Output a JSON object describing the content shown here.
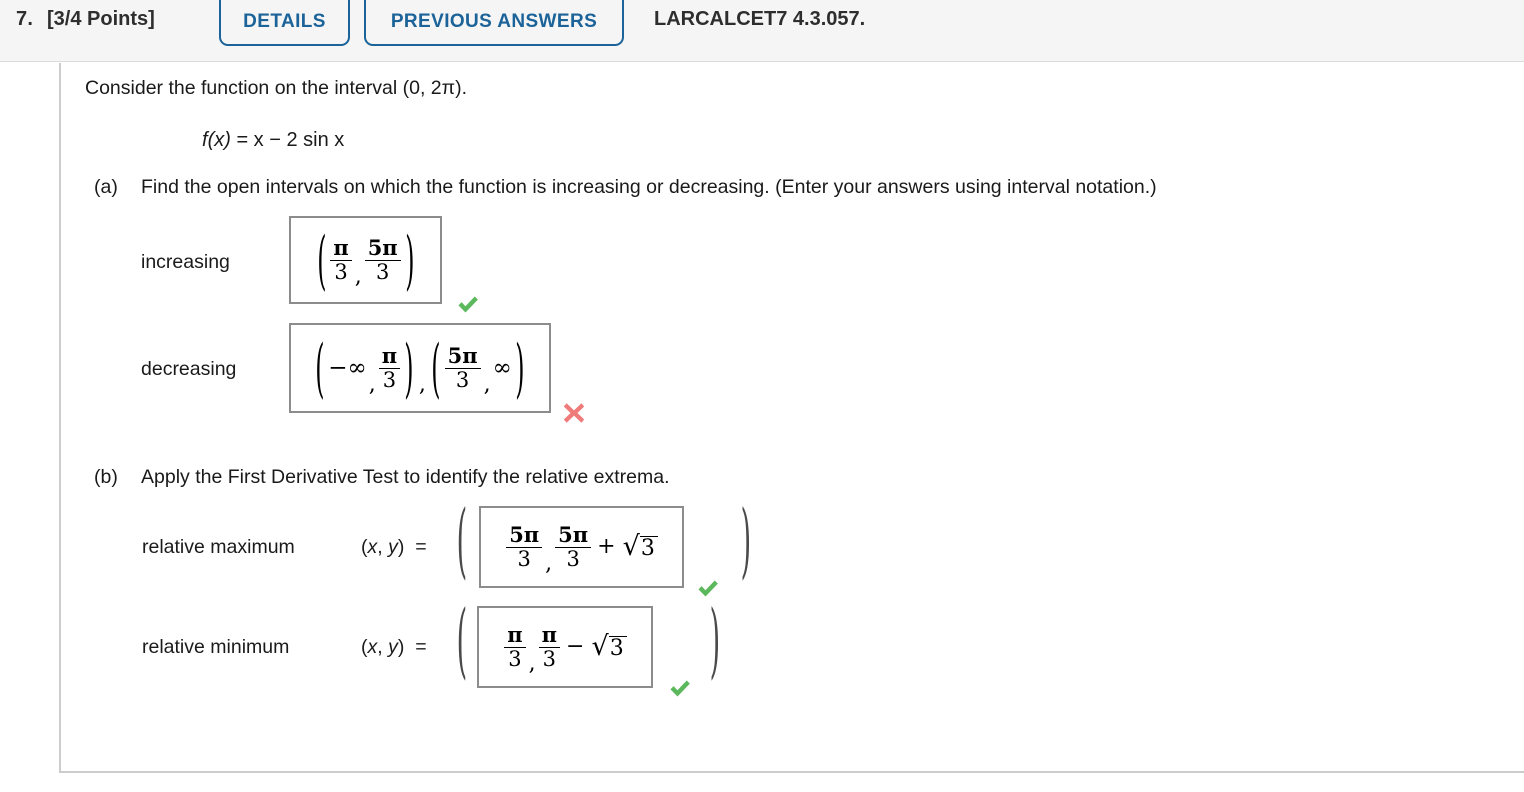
{
  "header": {
    "question_number": "7.",
    "points": "[3/4 Points]",
    "details_label": "DETAILS",
    "previous_answers_label": "PREVIOUS ANSWERS",
    "reference_code": "LARCALCET7 4.3.057.",
    "accent_color": "#1b6399",
    "background_color": "#f5f5f5"
  },
  "problem": {
    "intro": "Consider the function on the interval (0, 2π).",
    "function_f": "f",
    "function_arg": "(x)",
    "function_body": " = x − 2 sin x"
  },
  "parts": {
    "a": {
      "marker": "(a)",
      "prompt": "Find the open intervals on which the function is increasing or decreasing. (Enter your answers using interval notation.)",
      "increasing": {
        "label": "increasing",
        "answer_text": "(π/3, 5π/3)",
        "status": "correct",
        "status_symbol": "✔",
        "num1": "π",
        "den1": "3",
        "num2": "5π",
        "den2": "3"
      },
      "decreasing": {
        "label": "decreasing",
        "answer_text": "(−∞, π/3), (5π/3, ∞)",
        "status": "incorrect",
        "status_symbol": "✖",
        "neg_infinity": "−∞",
        "num1": "π",
        "den1": "3",
        "num2": "5π",
        "den2": "3",
        "infinity": "∞",
        "separator": ","
      }
    },
    "b": {
      "marker": "(b)",
      "prompt": "Apply the First Derivative Test to identify the relative extrema.",
      "relative_maximum": {
        "label": "relative maximum",
        "coord_label_open": "(",
        "coord_x": "x",
        "coord_sep": ", ",
        "coord_y": "y",
        "coord_label_close": ")",
        "equals": "=",
        "answer_text": "(5π/3, 5π/3 + √3)",
        "x_num": "5π",
        "x_den": "3",
        "y_num": "5π",
        "y_den": "3",
        "operator": "+",
        "radical_sign": "√",
        "radicand": "3",
        "status": "correct",
        "status_symbol": "✔"
      },
      "relative_minimum": {
        "label": "relative minimum",
        "coord_label_open": "(",
        "coord_x": "x",
        "coord_sep": ", ",
        "coord_y": "y",
        "coord_label_close": ")",
        "equals": "=",
        "answer_text": "(π/3, π/3 − √3)",
        "x_num": "π",
        "x_den": "3",
        "y_num": "π",
        "y_den": "3",
        "operator": "−",
        "radical_sign": "√",
        "radicand": "3",
        "status": "correct",
        "status_symbol": "✔"
      }
    }
  },
  "symbols": {
    "paren_open": "(",
    "paren_close": ")",
    "comma": ",",
    "colors": {
      "correct": "#5cb85c",
      "incorrect": "#ef7b7b",
      "box_border": "#8c8c8c",
      "panel_border": "#cccccc"
    }
  }
}
